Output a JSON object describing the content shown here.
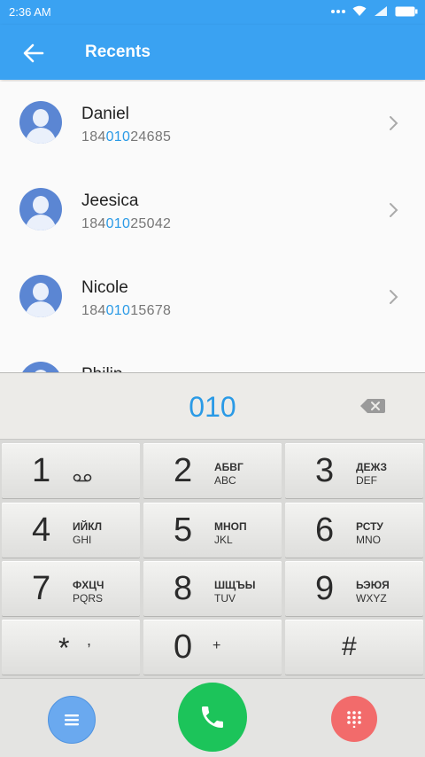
{
  "status": {
    "time": "2:36 AM"
  },
  "header": {
    "title": "Recents"
  },
  "contacts": [
    {
      "name": "Daniel",
      "prefix": "184",
      "match": "010",
      "suffix": "24685"
    },
    {
      "name": "Jeesica",
      "prefix": "184",
      "match": "010",
      "suffix": "25042"
    },
    {
      "name": "Nicole",
      "prefix": "184",
      "match": "010",
      "suffix": "15678"
    },
    {
      "name": "Philip"
    }
  ],
  "dial": {
    "input": "010"
  },
  "keys": [
    {
      "digit": "1",
      "l1": "",
      "l2": ""
    },
    {
      "digit": "2",
      "l1": "АБВГ",
      "l2": "ABC"
    },
    {
      "digit": "3",
      "l1": "ДЕЖЗ",
      "l2": "DEF"
    },
    {
      "digit": "4",
      "l1": "ИЙКЛ",
      "l2": "GHI"
    },
    {
      "digit": "5",
      "l1": "МНОП",
      "l2": "JKL"
    },
    {
      "digit": "6",
      "l1": "РСТУ",
      "l2": "MNO"
    },
    {
      "digit": "7",
      "l1": "ФХЦЧ",
      "l2": "PQRS"
    },
    {
      "digit": "8",
      "l1": "ШЩЪЫ",
      "l2": "TUV"
    },
    {
      "digit": "9",
      "l1": "ЬЭЮЯ",
      "l2": "WXYZ"
    },
    {
      "digit": "*",
      "l1": ",",
      "l2": ""
    },
    {
      "digit": "0",
      "l1": "+",
      "l2": ""
    },
    {
      "digit": "#",
      "l1": "",
      "l2": ""
    }
  ],
  "icons": {
    "menu": "menu-icon",
    "call": "phone-icon",
    "keypad": "dialpad-icon",
    "voicemail": "voicemail-icon",
    "backspace": "backspace-icon"
  },
  "colors": {
    "accent": "#3aa2f2",
    "highlight": "#2a9ae6",
    "menu_fab": "#6aa9ef",
    "call_fab": "#1cc45a",
    "keypad_fab": "#f26b6b",
    "avatar": "#5b86d3"
  }
}
